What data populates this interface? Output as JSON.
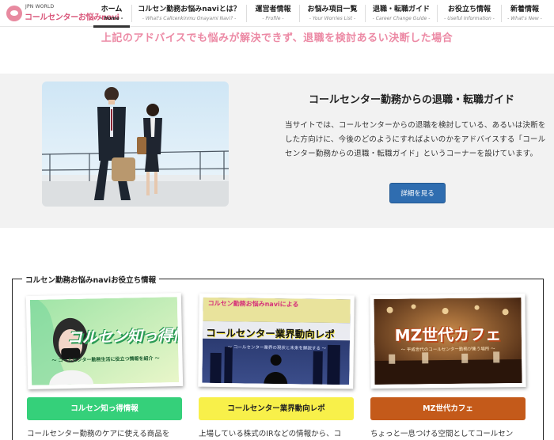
{
  "logo": {
    "small": "JPN WORLD",
    "main": "コールセンターお悩みnavi"
  },
  "nav": [
    {
      "jp": "ホーム",
      "en": "- Home -"
    },
    {
      "jp": "コルセン勤務お悩みnaviとは？",
      "en": "- What's Callcenkinmu Onayami Navi? -"
    },
    {
      "jp": "運営者情報",
      "en": "- Profile -"
    },
    {
      "jp": "お悩み項目一覧",
      "en": "- Your Worries List -"
    },
    {
      "jp": "退職・転職ガイド",
      "en": "- Career Change Guide -"
    },
    {
      "jp": "お役立ち情報",
      "en": "- Useful Information -"
    },
    {
      "jp": "新着情報",
      "en": "- What's New -"
    }
  ],
  "section_heading": "上記のアドバイスでも悩みが解決できず、退職を検討あるい決断した場合",
  "hero": {
    "title": "コールセンター勤務からの退職・転職ガイド",
    "text": "当サイトでは、コールセンターからの退職を検討している、あるいは決断をした方向けに、今後のどのようにすればよいのかをアドバイスする「コールセンター勤務からの退職・転職ガイド」というコーナーを設けています。",
    "button": "詳細を見る"
  },
  "useful": {
    "title": "コルセン勤務お悩みnaviお役立ち情報",
    "cards": [
      {
        "banner": "コルセン知っ得情報",
        "banner_sub": "～ コールセンター勤務生活に役立つ情報を紹介 ～",
        "button": "コルセン知っ得情報",
        "button_color": "#35d07a",
        "text": "コールセンター勤務のケアに使える商品を"
      },
      {
        "banner_top": "コルセン勤務お悩みnaviによる",
        "banner": "コールセンター業界動向レポ",
        "banner_sub": "～ コールセンター業界の現状と未来を解説する ～",
        "button": "コールセンター業界動向レポ",
        "button_color": "#f8f04a",
        "text": "上場している株式のIRなどの情報から、コ"
      },
      {
        "banner": "MZ世代カフェ",
        "banner_sub": "～ 平成世代のコールセンター勤務が集う場所 ～",
        "button": "MZ世代カフェ",
        "button_color": "#c45a1a",
        "text": "ちょっと一息つける空間としてコールセン"
      }
    ]
  }
}
